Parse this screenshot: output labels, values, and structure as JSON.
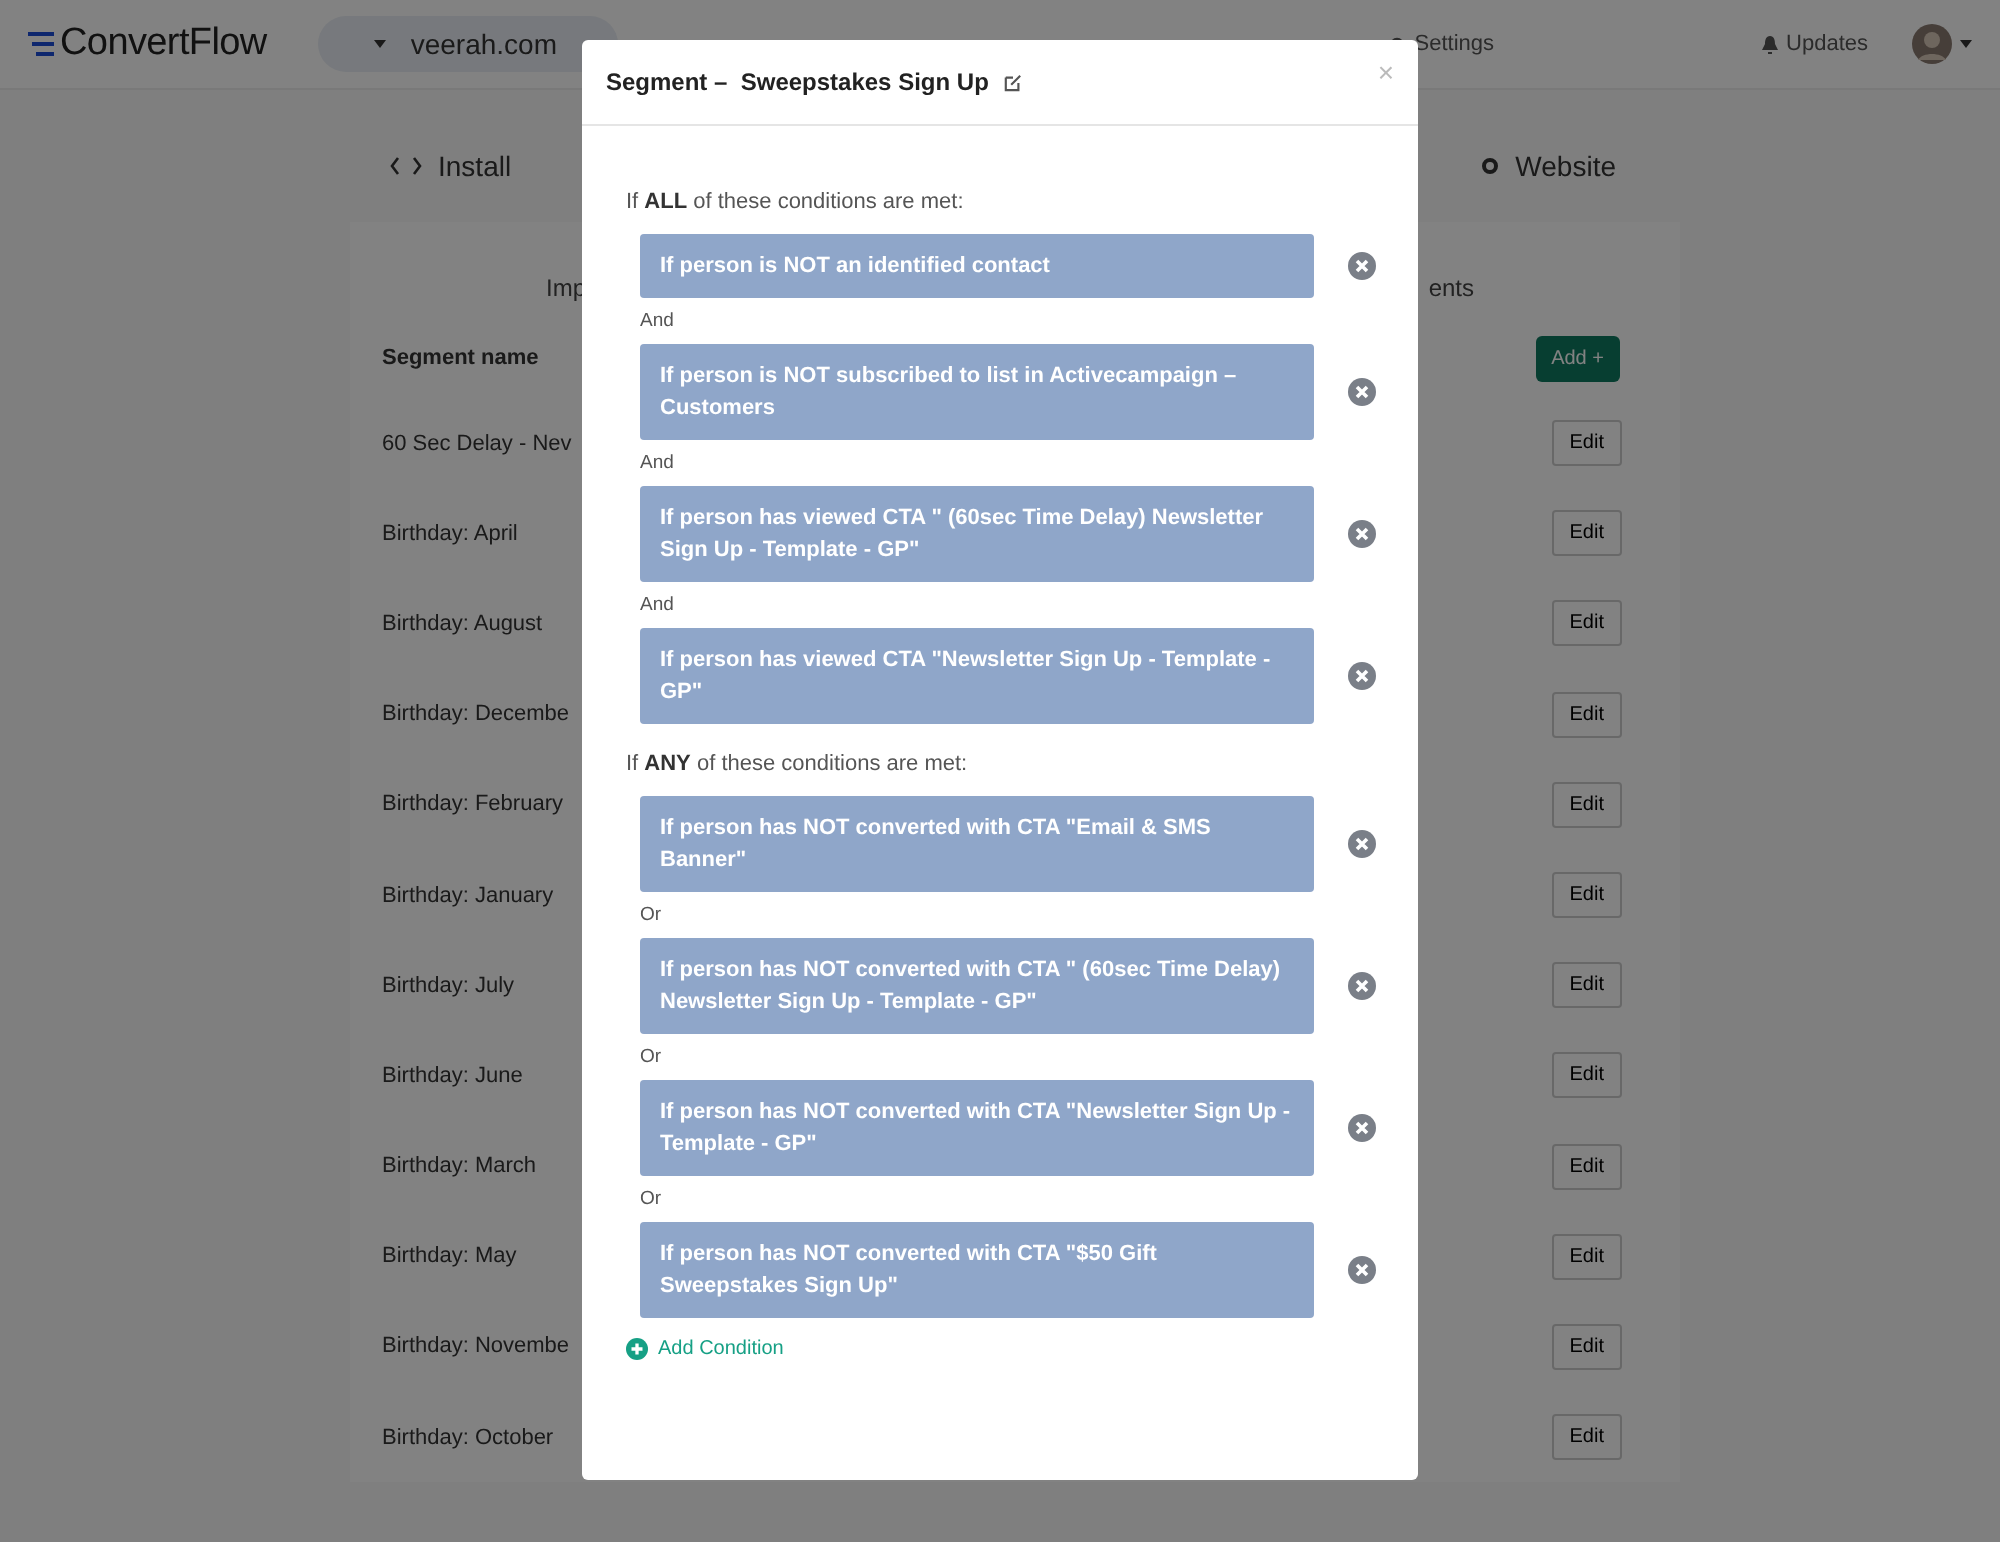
{
  "header": {
    "logo": "ConvertFlow",
    "site": "veerah.com",
    "nav": [
      {
        "label": "Settings"
      }
    ],
    "updates": "Updates"
  },
  "subnav": {
    "install": "Install",
    "website": "Website"
  },
  "partial_labels": {
    "left": "Imp",
    "right": "ents"
  },
  "table": {
    "column": "Segment name",
    "add_button": "Add +",
    "rows": [
      {
        "name": "60 Sec Delay - Nev",
        "action": "Edit"
      },
      {
        "name": "Birthday: April",
        "action": "Edit"
      },
      {
        "name": "Birthday: August",
        "action": "Edit"
      },
      {
        "name": "Birthday: Decembe",
        "action": "Edit"
      },
      {
        "name": "Birthday: February",
        "action": "Edit"
      },
      {
        "name": "Birthday: January",
        "action": "Edit"
      },
      {
        "name": "Birthday: July",
        "action": "Edit"
      },
      {
        "name": "Birthday: June",
        "action": "Edit"
      },
      {
        "name": "Birthday: March",
        "action": "Edit"
      },
      {
        "name": "Birthday: May",
        "action": "Edit"
      },
      {
        "name": "Birthday: Novembe",
        "action": "Edit"
      },
      {
        "name": "Birthday: October",
        "action": "Edit"
      }
    ]
  },
  "modal": {
    "title": "Segment –  Sweepstakes Sign Up",
    "close": "×",
    "groups": [
      {
        "intro": "If **ALL** of these conditions are met:",
        "conditions": [
          {
            "text": "If person is NOT an identified contact"
          },
          {
            "connector": "And",
            "text": "If person is NOT subscribed to list in Activecampaign –  Customers"
          },
          {
            "connector": "And",
            "text": "If person has viewed CTA \" (60sec Time Delay) Newsletter Sign Up - Template - GP\""
          },
          {
            "connector": "And",
            "text": "If person has viewed CTA \"Newsletter Sign Up - Template - GP\""
          }
        ]
      },
      {
        "intro": "If **ANY** of these conditions are met:",
        "conditions": [
          {
            "text": "If person has NOT converted with CTA \"Email & SMS Banner\""
          },
          {
            "connector": "Or",
            "text": "If person has NOT converted with CTA \" (60sec Time Delay) Newsletter Sign Up - Template - GP\""
          },
          {
            "connector": "Or",
            "text": "If person has NOT converted with CTA \"Newsletter Sign Up - Template - GP\""
          },
          {
            "connector": "Or",
            "text": "If person has NOT converted with CTA \"$50 Gift Sweepstakes Sign Up\""
          }
        ]
      }
    ],
    "add_condition": "Add Condition"
  }
}
